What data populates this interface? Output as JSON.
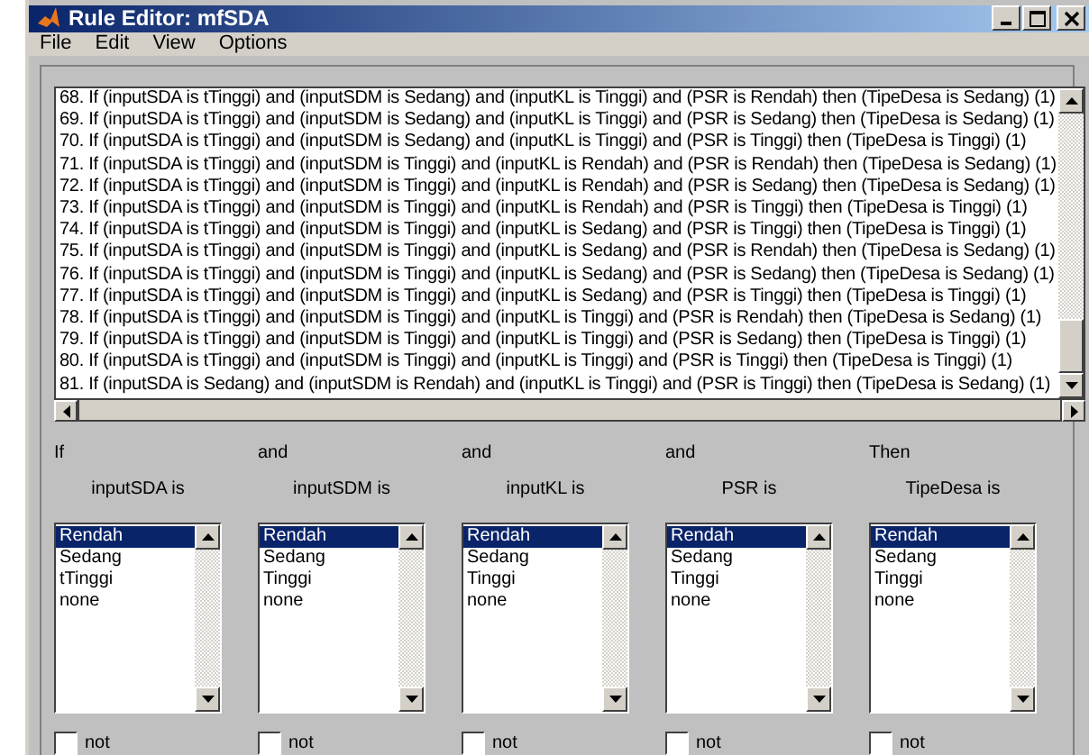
{
  "window": {
    "title": "Rule Editor: mfSDA"
  },
  "menu": [
    "File",
    "Edit",
    "View",
    "Options"
  ],
  "rules": [
    "68. If (inputSDA is tTinggi) and (inputSDM is Sedang) and (inputKL is Tinggi) and (PSR is Rendah) then (TipeDesa is Sedang) (1)",
    "69. If (inputSDA is tTinggi) and (inputSDM is Sedang) and (inputKL is Tinggi) and (PSR is Sedang) then (TipeDesa is Sedang) (1)",
    "70. If (inputSDA is tTinggi) and (inputSDM is Sedang) and (inputKL is Tinggi) and (PSR is Tinggi) then (TipeDesa is Tinggi) (1)",
    "71. If (inputSDA is tTinggi) and (inputSDM is Tinggi) and (inputKL is Rendah) and (PSR is Rendah) then (TipeDesa is Sedang) (1)",
    "72. If (inputSDA is tTinggi) and (inputSDM is Tinggi) and (inputKL is Rendah) and (PSR is Sedang) then (TipeDesa is Sedang) (1)",
    "73. If (inputSDA is tTinggi) and (inputSDM is Tinggi) and (inputKL is Rendah) and (PSR is Tinggi) then (TipeDesa is Tinggi) (1)",
    "74. If (inputSDA is tTinggi) and (inputSDM is Tinggi) and (inputKL is Sedang) and (PSR is Tinggi) then (TipeDesa is Tinggi) (1)",
    "75. If (inputSDA is tTinggi) and (inputSDM is Tinggi) and (inputKL is Sedang) and (PSR is Rendah) then (TipeDesa is Sedang) (1)",
    "76. If (inputSDA is tTinggi) and (inputSDM is Tinggi) and (inputKL is Sedang) and (PSR is Sedang) then (TipeDesa is Sedang) (1)",
    "77. If (inputSDA is tTinggi) and (inputSDM is Tinggi) and (inputKL is Sedang) and (PSR is Tinggi) then (TipeDesa is Tinggi) (1)",
    "78. If (inputSDA is tTinggi) and (inputSDM is Tinggi) and (inputKL is Tinggi) and (PSR is Rendah) then (TipeDesa is Sedang) (1)",
    "79. If (inputSDA is tTinggi) and (inputSDM is Tinggi) and (inputKL is Tinggi) and (PSR is Sedang) then (TipeDesa is Tinggi) (1)",
    "80. If (inputSDA is tTinggi) and (inputSDM is Tinggi) and (inputKL is Tinggi) and (PSR is Tinggi) then (TipeDesa is Tinggi) (1)",
    "81. If (inputSDA is Sedang) and (inputSDM is Rendah) and (inputKL is Tinggi) and (PSR is Tinggi) then (TipeDesa is Sedang) (1)"
  ],
  "columns": [
    {
      "connector": "If",
      "label": "inputSDA is",
      "options": [
        {
          "label": "Rendah",
          "selected": true
        },
        {
          "label": "Sedang",
          "selected": false
        },
        {
          "label": "tTinggi",
          "selected": false
        },
        {
          "label": "none",
          "selected": false
        }
      ],
      "not": {
        "label": "not",
        "checked": false
      }
    },
    {
      "connector": "and",
      "label": "inputSDM is",
      "options": [
        {
          "label": "Rendah",
          "selected": true
        },
        {
          "label": "Sedang",
          "selected": false
        },
        {
          "label": "Tinggi",
          "selected": false
        },
        {
          "label": "none",
          "selected": false
        }
      ],
      "not": {
        "label": "not",
        "checked": false
      }
    },
    {
      "connector": "and",
      "label": "inputKL is",
      "options": [
        {
          "label": "Rendah",
          "selected": true
        },
        {
          "label": "Sedang",
          "selected": false
        },
        {
          "label": "Tinggi",
          "selected": false
        },
        {
          "label": "none",
          "selected": false
        }
      ],
      "not": {
        "label": "not",
        "checked": false
      }
    },
    {
      "connector": "and",
      "label": "PSR is",
      "options": [
        {
          "label": "Rendah",
          "selected": true
        },
        {
          "label": "Sedang",
          "selected": false
        },
        {
          "label": "Tinggi",
          "selected": false
        },
        {
          "label": "none",
          "selected": false
        }
      ],
      "not": {
        "label": "not",
        "checked": false
      }
    },
    {
      "connector": "Then",
      "label": "TipeDesa is",
      "options": [
        {
          "label": "Rendah",
          "selected": true
        },
        {
          "label": "Sedang",
          "selected": false
        },
        {
          "label": "Tinggi",
          "selected": false
        },
        {
          "label": "none",
          "selected": false
        }
      ],
      "not": {
        "label": "not",
        "checked": false
      }
    }
  ]
}
